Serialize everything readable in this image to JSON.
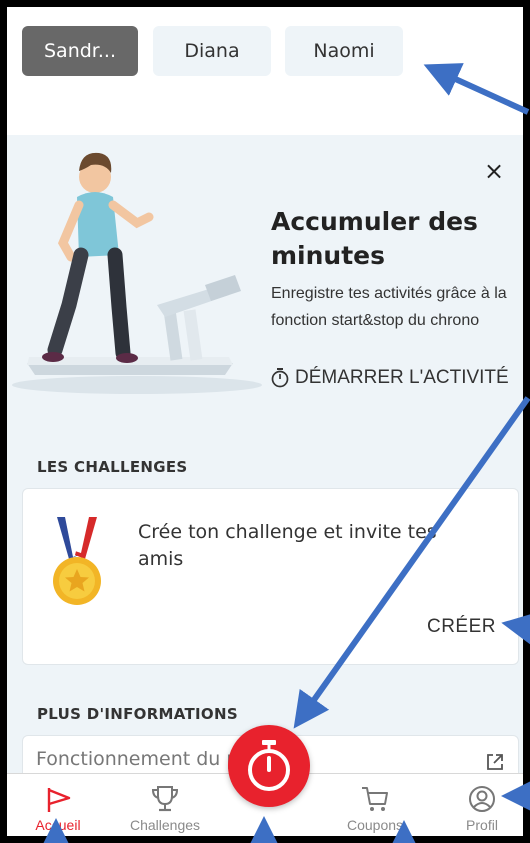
{
  "profiles": [
    {
      "label": "Sandr...",
      "active": true
    },
    {
      "label": "Diana",
      "active": false
    },
    {
      "label": "Naomi",
      "active": false
    }
  ],
  "promo": {
    "close_label": "×",
    "title": "Accumuler des minutes",
    "description": "Enregistre tes activités grâce à la fonction start&stop du chrono",
    "action_label": "DÉMARRER L'ACTIVITÉ",
    "illustration": "man-on-treadmill"
  },
  "challenges": {
    "section_title": "LES CHALLENGES",
    "card_text": "Crée ton challenge et invite tes amis",
    "create_label": "CRÉER",
    "icon": "medal-icon"
  },
  "info": {
    "section_title": "PLUS D'INFORMATIONS",
    "item_label": "Fonctionnement du projet",
    "icon": "external-link-icon"
  },
  "nav": {
    "home": "Accueil",
    "challenges": "Challenges",
    "coupons": "Coupons",
    "profile": "Profil",
    "fab_icon": "stopwatch-icon"
  },
  "colors": {
    "accent": "#e8222d",
    "active_chip": "#686868",
    "annotation_arrow": "#3d6fc4"
  }
}
